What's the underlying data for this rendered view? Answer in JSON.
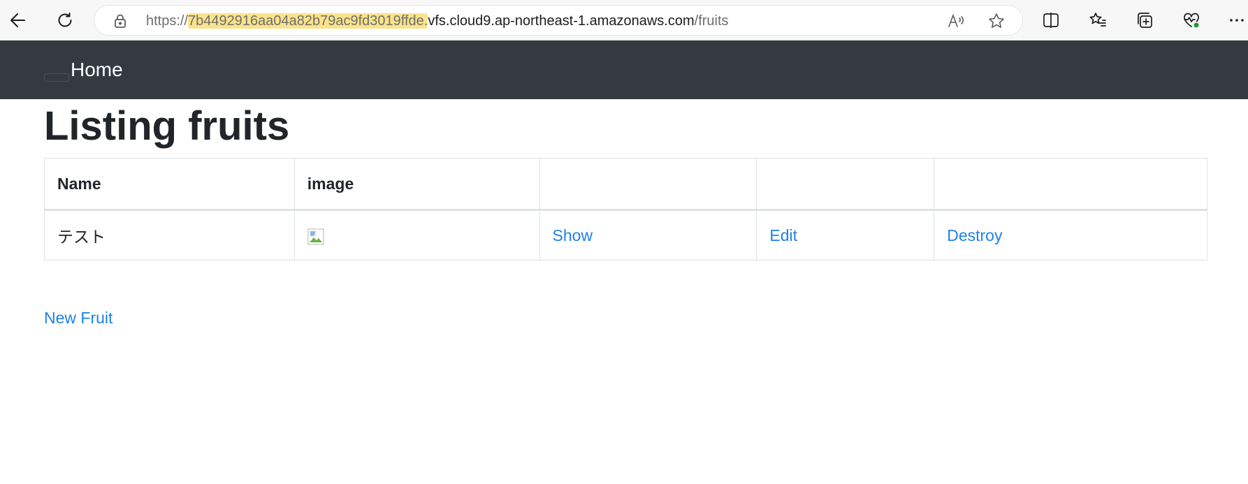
{
  "browser": {
    "url_scheme": "https://",
    "url_highlight": "7b4492916aa04a82b79ac9fd3019ffde.",
    "url_domain": "vfs.cloud9.ap-northeast-1.amazonaws.com",
    "url_path": "/fruits",
    "badge_color": "#1c9a3b"
  },
  "navbar": {
    "home_label": "Home",
    "background": "#343a40"
  },
  "page": {
    "title": "Listing fruits",
    "new_link": "New Fruit",
    "link_color": "#1e82e6"
  },
  "table": {
    "headers": [
      "Name",
      "image",
      "",
      "",
      ""
    ],
    "rows": [
      {
        "name": "テスト",
        "image_alt": "",
        "show": "Show",
        "edit": "Edit",
        "destroy": "Destroy"
      }
    ]
  }
}
